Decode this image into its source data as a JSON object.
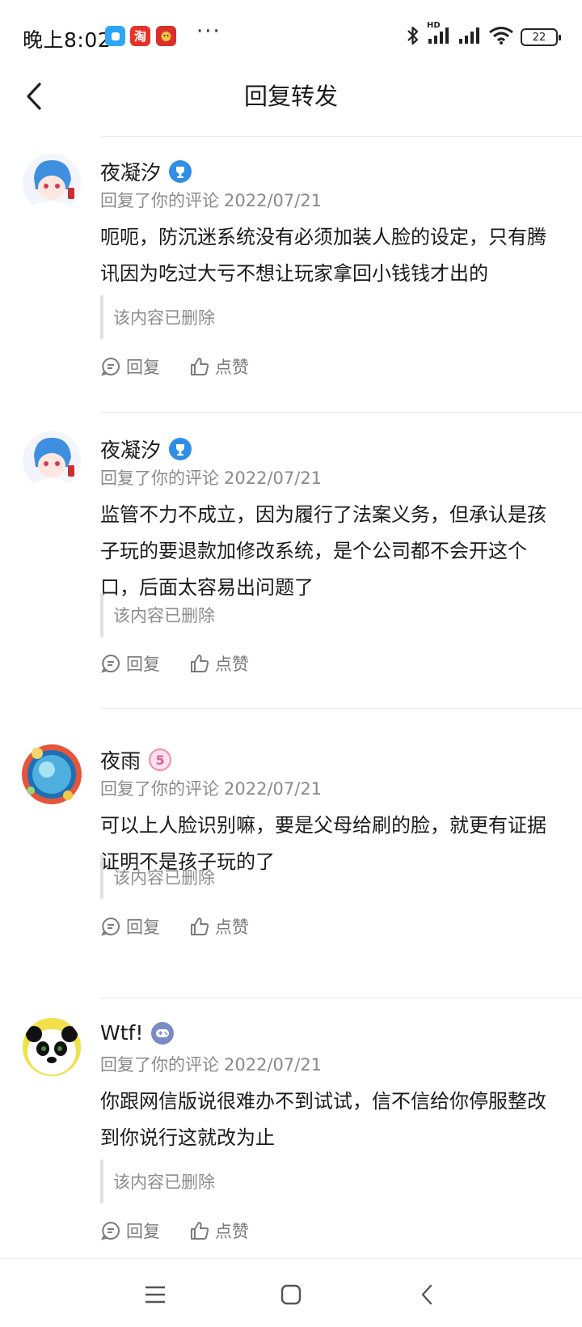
{
  "status_bar": {
    "time": "晚上8:02",
    "app_icons": [
      "tencent-app-icon",
      "taobao-app-icon",
      "game-app-icon"
    ],
    "taobao_glyph": "淘",
    "more_dots": "···",
    "network_label": "HD",
    "battery_level": "22"
  },
  "header": {
    "title": "回复转发"
  },
  "comments": [
    {
      "username": "夜凝汐",
      "badge": "trophy-badge",
      "action_text": "回复了你的评论",
      "date": "2022/07/21",
      "text": "呃呃，防沉迷系统没有必须加装人脸的设定，只有腾讯因为吃过大亏不想让玩家拿回小钱钱才出的",
      "quoted": "该内容已删除",
      "reply_label": "回复",
      "like_label": "点赞"
    },
    {
      "username": "夜凝汐",
      "badge": "trophy-badge",
      "action_text": "回复了你的评论",
      "date": "2022/07/21",
      "text": "监管不力不成立，因为履行了法案义务，但承认是孩子玩的要退款加修改系统，是个公司都不会开这个口，后面太容易出问题了",
      "quoted": "该内容已删除",
      "reply_label": "回复",
      "like_label": "点赞"
    },
    {
      "username": "夜雨",
      "badge": "level-5-badge",
      "badge_text": "5",
      "action_text": "回复了你的评论",
      "date": "2022/07/21",
      "text": "可以上人脸识别嘛，要是父母给刷的脸，就更有证据证明不是孩子玩的了",
      "quoted": "该内容已删除",
      "reply_label": "回复",
      "like_label": "点赞"
    },
    {
      "username": "Wtf!",
      "badge": "gamepad-badge",
      "action_text": "回复了你的评论",
      "date": "2022/07/21",
      "text": "你跟网信版说很难办不到试试，信不信给你停服整改到你说行这就改为止",
      "quoted": "该内容已删除",
      "reply_label": "回复",
      "like_label": "点赞"
    }
  ],
  "colors": {
    "text_primary": "#1a1a1a",
    "text_secondary": "#8a8a8a",
    "badge_blue": "#2f8fe6",
    "badge_pink": "#f08bb0",
    "badge_gamepad": "#7c8bc7",
    "divider": "#ececec"
  }
}
